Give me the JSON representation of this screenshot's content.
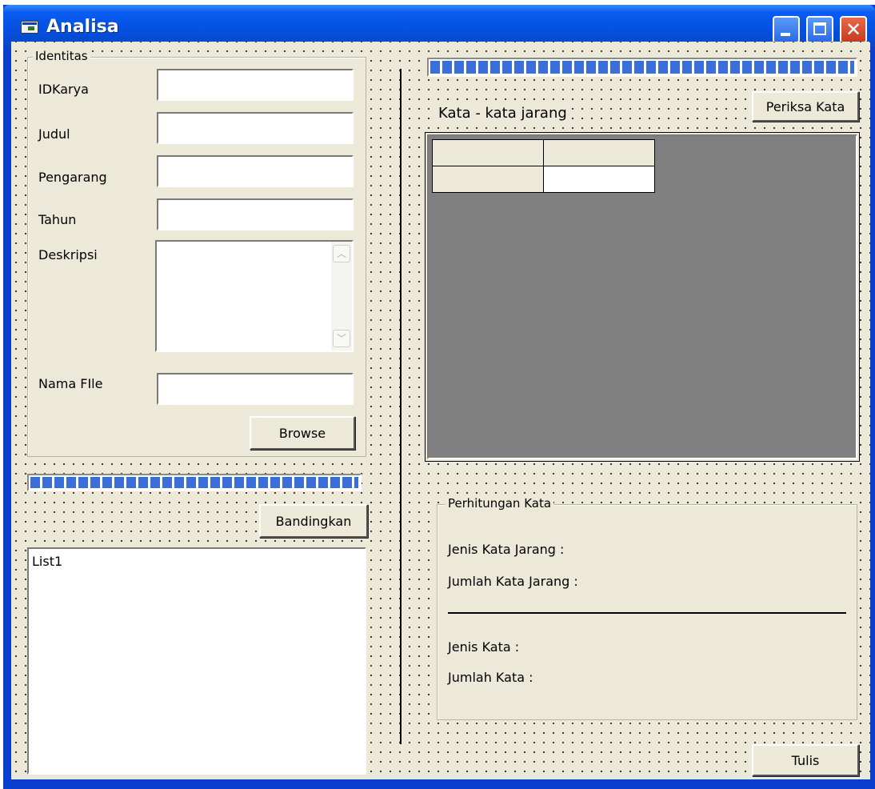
{
  "window": {
    "title": "Analisa",
    "close_glyph": "✕"
  },
  "identitas": {
    "legend": "Identitas",
    "fields": {
      "idkarya": {
        "label": "IDKarya",
        "value": ""
      },
      "judul": {
        "label": "Judul",
        "value": ""
      },
      "pengarang": {
        "label": "Pengarang",
        "value": ""
      },
      "tahun": {
        "label": "Tahun",
        "value": ""
      },
      "deskripsi": {
        "label": "Deskripsi",
        "value": ""
      },
      "nama_file": {
        "label": "Nama FIle",
        "value": ""
      }
    },
    "browse_label": "Browse"
  },
  "left_progress": {
    "percent": 100
  },
  "bandingkan_label": "Bandingkan",
  "list": {
    "items": [
      "List1"
    ]
  },
  "right_progress": {
    "percent": 100
  },
  "kata_jarang_label": "Kata - kata jarang",
  "periksa_label": "Periksa Kata",
  "perhitungan": {
    "legend": "Perhitungan Kata",
    "jenis_jarang": "Jenis Kata Jarang :",
    "jumlah_jarang": "Jumlah Kata Jarang :",
    "jenis_kata": "Jenis Kata :",
    "jumlah_kata": "Jumlah Kata :"
  },
  "tulis_label": "Tulis",
  "icons": {
    "app": "app-window-icon",
    "minimize": "minimize-icon",
    "maximize": "maximize-icon",
    "close": "close-icon",
    "scroll_up": "scroll-up-arrow-icon",
    "scroll_down": "scroll-down-arrow-icon"
  }
}
